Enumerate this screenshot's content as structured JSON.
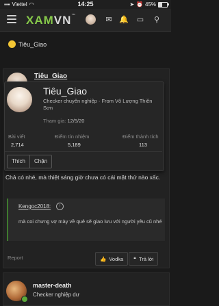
{
  "status_bar": {
    "carrier": "Viettel",
    "time": "14:25",
    "battery_text": "45%",
    "battery_level": 0.45
  },
  "header": {
    "logo_part1": "XAM",
    "logo_part2": "VN",
    "logo_suffix": "™"
  },
  "context": {
    "username": "Tiêu_Giao"
  },
  "post": {
    "author": "Tiêu_Giao",
    "body": "Chả có nhé, mà thiệt sáng giờ chưa có cái mặt thứ nào xấc.",
    "quote": {
      "author": "Kengoc2018:",
      "text": "mà coi chưng vợ mày về quê sẽ giao lưu với người yêu cũ nhé"
    },
    "report_label": "Report",
    "vodka_label": "Vodka",
    "reply_label": "Trả lời"
  },
  "member_tooltip": {
    "name": "Tiêu_Giao",
    "title": "Checker chuyên nghiệp · From Vô Lượng Thiên Sơn",
    "joined_label": "Tham gia:",
    "joined_date": "12/5/20",
    "stats": [
      {
        "label": "Bài viết",
        "value": "2,714"
      },
      {
        "label": "Điểm tín nhiệm",
        "value": "5,189"
      },
      {
        "label": "Điểm thành tích",
        "value": "113"
      }
    ],
    "buttons": {
      "follow": "Thích",
      "ignore": "Chặn"
    }
  },
  "next_post": {
    "author": "master-death",
    "title": "Checker nghiệp dư"
  },
  "colors": {
    "brand_green": "#86c94a",
    "background": "#1a1a1a",
    "online": "#5aa93a"
  }
}
